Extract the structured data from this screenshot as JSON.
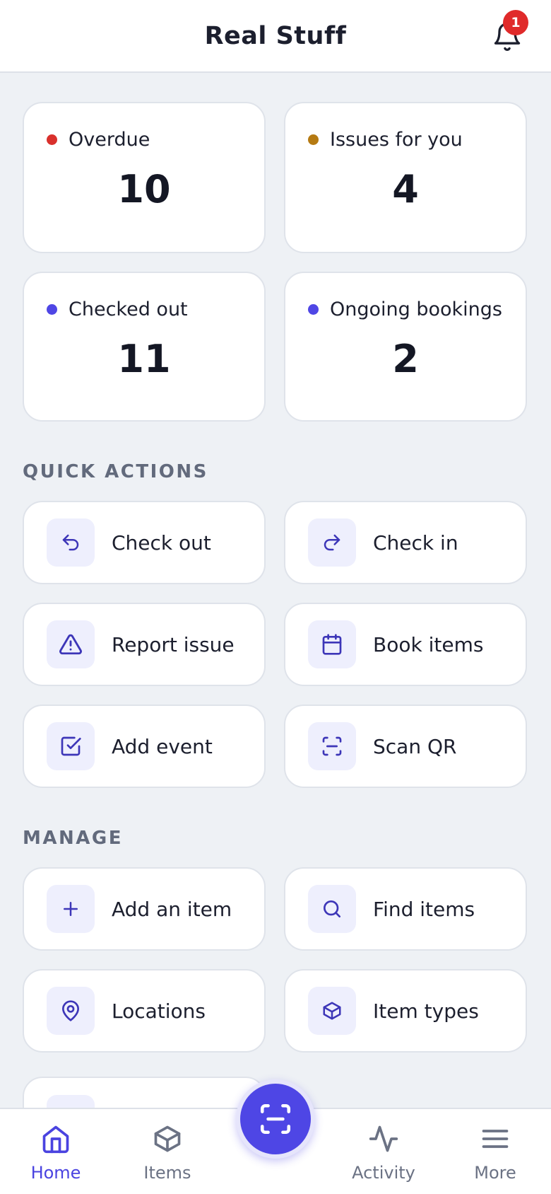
{
  "header": {
    "title": "Real Stuff",
    "notification_count": "1"
  },
  "stats": [
    {
      "label": "Overdue",
      "value": "10",
      "color": "#d9302c"
    },
    {
      "label": "Issues for you",
      "value": "4",
      "color": "#b57a12"
    },
    {
      "label": "Checked out",
      "value": "11",
      "color": "#4f46e5"
    },
    {
      "label": "Ongoing bookings",
      "value": "2",
      "color": "#4f46e5"
    }
  ],
  "quick_actions": {
    "title": "QUICK ACTIONS",
    "items": [
      {
        "label": "Check out",
        "icon": "arrow-back-icon"
      },
      {
        "label": "Check in",
        "icon": "arrow-forward-icon"
      },
      {
        "label": "Report issue",
        "icon": "warning-icon"
      },
      {
        "label": "Book items",
        "icon": "calendar-icon"
      },
      {
        "label": "Add event",
        "icon": "checkbox-icon"
      },
      {
        "label": "Scan QR",
        "icon": "scan-icon"
      }
    ]
  },
  "manage": {
    "title": "MANAGE",
    "items": [
      {
        "label": "Add an item",
        "icon": "plus-icon"
      },
      {
        "label": "Find items",
        "icon": "search-icon"
      },
      {
        "label": "Locations",
        "icon": "location-pin-icon"
      },
      {
        "label": "Item types",
        "icon": "cube-icon"
      }
    ]
  },
  "nav": {
    "items": [
      {
        "label": "Home",
        "icon": "home-icon",
        "active": true
      },
      {
        "label": "Items",
        "icon": "cube-icon"
      },
      {
        "label": "Activity",
        "icon": "activity-icon"
      },
      {
        "label": "More",
        "icon": "menu-icon"
      }
    ],
    "fab_icon": "scan-icon"
  },
  "colors": {
    "accent": "#4f46e5",
    "badge": "#e02a2a",
    "background": "#eef1f5"
  }
}
